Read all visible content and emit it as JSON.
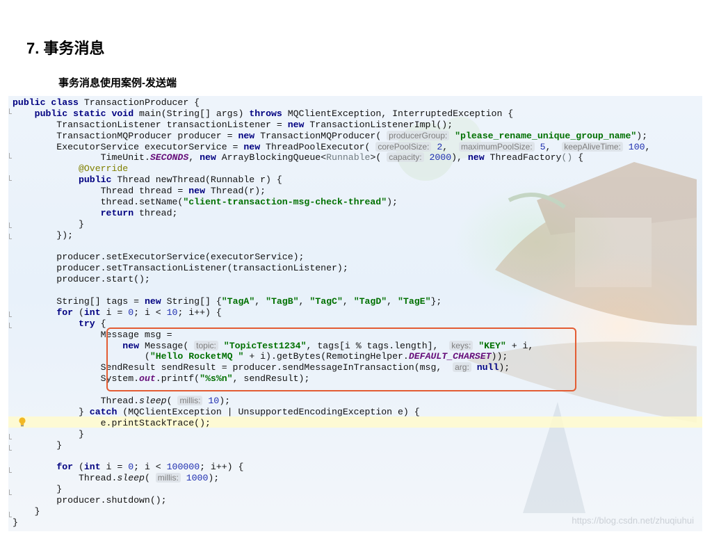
{
  "page": {
    "title": "7. 事务消息",
    "subtitle": "事务消息使用案例-发送端",
    "watermark": "https://blog.csdn.net/zhuqiuhui"
  },
  "colors": {
    "keyword": "#000080",
    "string": "#007000",
    "number": "#1f2fb0",
    "highlight_box": "#e35c33",
    "caret_line": "#fffacd"
  },
  "icons": [
    "lightbulb-icon",
    "gutter-fold-icon"
  ],
  "code": [
    [
      {
        "t": "kw",
        "v": "public"
      },
      {
        "v": " "
      },
      {
        "t": "kw",
        "v": "class"
      },
      {
        "v": " TransactionProducer {"
      }
    ],
    [
      {
        "v": "    "
      },
      {
        "t": "kw",
        "v": "public"
      },
      {
        "v": " "
      },
      {
        "t": "kw",
        "v": "static"
      },
      {
        "v": " "
      },
      {
        "t": "kw",
        "v": "void"
      },
      {
        "v": " main(String[] args) "
      },
      {
        "t": "kw",
        "v": "throws"
      },
      {
        "v": " MQClientException, InterruptedException {"
      }
    ],
    [
      {
        "v": "        TransactionListener transactionListener = "
      },
      {
        "t": "kw",
        "v": "new"
      },
      {
        "v": " TransactionListenerImpl();"
      }
    ],
    [
      {
        "v": "        TransactionMQProducer producer = "
      },
      {
        "t": "kw",
        "v": "new"
      },
      {
        "v": " TransactionMQProducer( "
      },
      {
        "t": "hint",
        "v": "producerGroup:"
      },
      {
        "v": " "
      },
      {
        "t": "str",
        "v": "\"please_rename_unique_group_name\""
      },
      {
        "v": ");"
      }
    ],
    [
      {
        "v": "        ExecutorService executorService = "
      },
      {
        "t": "kw",
        "v": "new"
      },
      {
        "v": " ThreadPoolExecutor( "
      },
      {
        "t": "hint",
        "v": "corePoolSize:"
      },
      {
        "v": " "
      },
      {
        "t": "num",
        "v": "2"
      },
      {
        "v": ",  "
      },
      {
        "t": "hint",
        "v": "maximumPoolSize:"
      },
      {
        "v": " "
      },
      {
        "t": "num",
        "v": "5"
      },
      {
        "v": ",  "
      },
      {
        "t": "hint",
        "v": "keepAliveTime:"
      },
      {
        "v": " "
      },
      {
        "t": "num",
        "v": "100"
      },
      {
        "v": ","
      }
    ],
    [
      {
        "v": "                TimeUnit."
      },
      {
        "t": "field",
        "v": "SECONDS"
      },
      {
        "v": ", "
      },
      {
        "t": "kw",
        "v": "new"
      },
      {
        "v": " ArrayBlockingQueue<"
      },
      {
        "t": "gen",
        "v": "Runnable"
      },
      {
        "v": ">( "
      },
      {
        "t": "hint",
        "v": "capacity:"
      },
      {
        "v": " "
      },
      {
        "t": "num",
        "v": "2000"
      },
      {
        "v": "), "
      },
      {
        "t": "kw",
        "v": "new"
      },
      {
        "v": " ThreadFactory"
      },
      {
        "t": "gen",
        "v": "()"
      },
      {
        "v": " {"
      }
    ],
    [
      {
        "v": "            "
      },
      {
        "t": "anno",
        "v": "@Override"
      }
    ],
    [
      {
        "v": "            "
      },
      {
        "t": "kw",
        "v": "public"
      },
      {
        "v": " Thread newThread(Runnable r) {"
      }
    ],
    [
      {
        "v": "                Thread thread = "
      },
      {
        "t": "kw",
        "v": "new"
      },
      {
        "v": " Thread(r);"
      }
    ],
    [
      {
        "v": "                thread.setName("
      },
      {
        "t": "str",
        "v": "\"client-transaction-msg-check-thread\""
      },
      {
        "v": ");"
      }
    ],
    [
      {
        "v": "                "
      },
      {
        "t": "kw",
        "v": "return"
      },
      {
        "v": " thread;"
      }
    ],
    [
      {
        "v": "            }"
      }
    ],
    [
      {
        "v": "        });"
      }
    ],
    [
      {
        "v": ""
      }
    ],
    [
      {
        "v": "        producer.setExecutorService(executorService);"
      }
    ],
    [
      {
        "v": "        producer.setTransactionListener(transactionListener);"
      }
    ],
    [
      {
        "v": "        producer.start();"
      }
    ],
    [
      {
        "v": ""
      }
    ],
    [
      {
        "v": "        String[] tags = "
      },
      {
        "t": "kw",
        "v": "new"
      },
      {
        "v": " String[] {"
      },
      {
        "t": "str",
        "v": "\"TagA\""
      },
      {
        "v": ", "
      },
      {
        "t": "str",
        "v": "\"TagB\""
      },
      {
        "v": ", "
      },
      {
        "t": "str",
        "v": "\"TagC\""
      },
      {
        "v": ", "
      },
      {
        "t": "str",
        "v": "\"TagD\""
      },
      {
        "v": ", "
      },
      {
        "t": "str",
        "v": "\"TagE\""
      },
      {
        "v": "};"
      }
    ],
    [
      {
        "v": "        "
      },
      {
        "t": "kw",
        "v": "for"
      },
      {
        "v": " ("
      },
      {
        "t": "kw",
        "v": "int"
      },
      {
        "v": " i = "
      },
      {
        "t": "num",
        "v": "0"
      },
      {
        "v": "; i < "
      },
      {
        "t": "num",
        "v": "10"
      },
      {
        "v": "; i++) {"
      }
    ],
    [
      {
        "v": "            "
      },
      {
        "t": "kw",
        "v": "try"
      },
      {
        "v": " {"
      }
    ],
    [
      {
        "v": "                Message msg ="
      }
    ],
    [
      {
        "v": "                    "
      },
      {
        "t": "kw",
        "v": "new"
      },
      {
        "v": " Message( "
      },
      {
        "t": "hint",
        "v": "topic:"
      },
      {
        "v": " "
      },
      {
        "t": "str",
        "v": "\"TopicTest1234\""
      },
      {
        "v": ", tags[i % tags.length],  "
      },
      {
        "t": "hint",
        "v": "keys:"
      },
      {
        "v": " "
      },
      {
        "t": "str",
        "v": "\"KEY\""
      },
      {
        "v": " + i,"
      }
    ],
    [
      {
        "v": "                        ("
      },
      {
        "t": "str",
        "v": "\"Hello RocketMQ \""
      },
      {
        "v": " + i).getBytes(RemotingHelper."
      },
      {
        "t": "field",
        "v": "DEFAULT_CHARSET"
      },
      {
        "v": "));"
      }
    ],
    [
      {
        "v": "                SendResult sendResult = producer.sendMessageInTransaction(msg,  "
      },
      {
        "t": "hint",
        "v": "arg:"
      },
      {
        "v": " "
      },
      {
        "t": "kw",
        "v": "null"
      },
      {
        "v": ");"
      }
    ],
    [
      {
        "v": "                System."
      },
      {
        "t": "field",
        "v": "out"
      },
      {
        "v": ".printf("
      },
      {
        "t": "str",
        "v": "\"%s%n\""
      },
      {
        "v": ", sendResult);"
      }
    ],
    [
      {
        "v": ""
      }
    ],
    [
      {
        "v": "                Thread."
      },
      {
        "t": "ital",
        "v": "sleep"
      },
      {
        "v": "( "
      },
      {
        "t": "hint",
        "v": "millis:"
      },
      {
        "v": " "
      },
      {
        "t": "num",
        "v": "10"
      },
      {
        "v": ");"
      }
    ],
    [
      {
        "v": "            } "
      },
      {
        "t": "kw",
        "v": "catch"
      },
      {
        "v": " (MQClientException | UnsupportedEncodingException e) {"
      }
    ],
    [
      {
        "v": "                e.printStackTrace();"
      }
    ],
    [
      {
        "v": "            }"
      }
    ],
    [
      {
        "v": "        }"
      }
    ],
    [
      {
        "v": ""
      }
    ],
    [
      {
        "v": "        "
      },
      {
        "t": "kw",
        "v": "for"
      },
      {
        "v": " ("
      },
      {
        "t": "kw",
        "v": "int"
      },
      {
        "v": " i = "
      },
      {
        "t": "num",
        "v": "0"
      },
      {
        "v": "; i < "
      },
      {
        "t": "num",
        "v": "100000"
      },
      {
        "v": "; i++) {"
      }
    ],
    [
      {
        "v": "            Thread."
      },
      {
        "t": "ital",
        "v": "sleep"
      },
      {
        "v": "( "
      },
      {
        "t": "hint",
        "v": "millis:"
      },
      {
        "v": " "
      },
      {
        "t": "num",
        "v": "1000"
      },
      {
        "v": ");"
      }
    ],
    [
      {
        "v": "        }"
      }
    ],
    [
      {
        "v": "        producer.shutdown();"
      }
    ],
    [
      {
        "v": "    }"
      }
    ],
    [
      {
        "v": "}"
      }
    ]
  ]
}
